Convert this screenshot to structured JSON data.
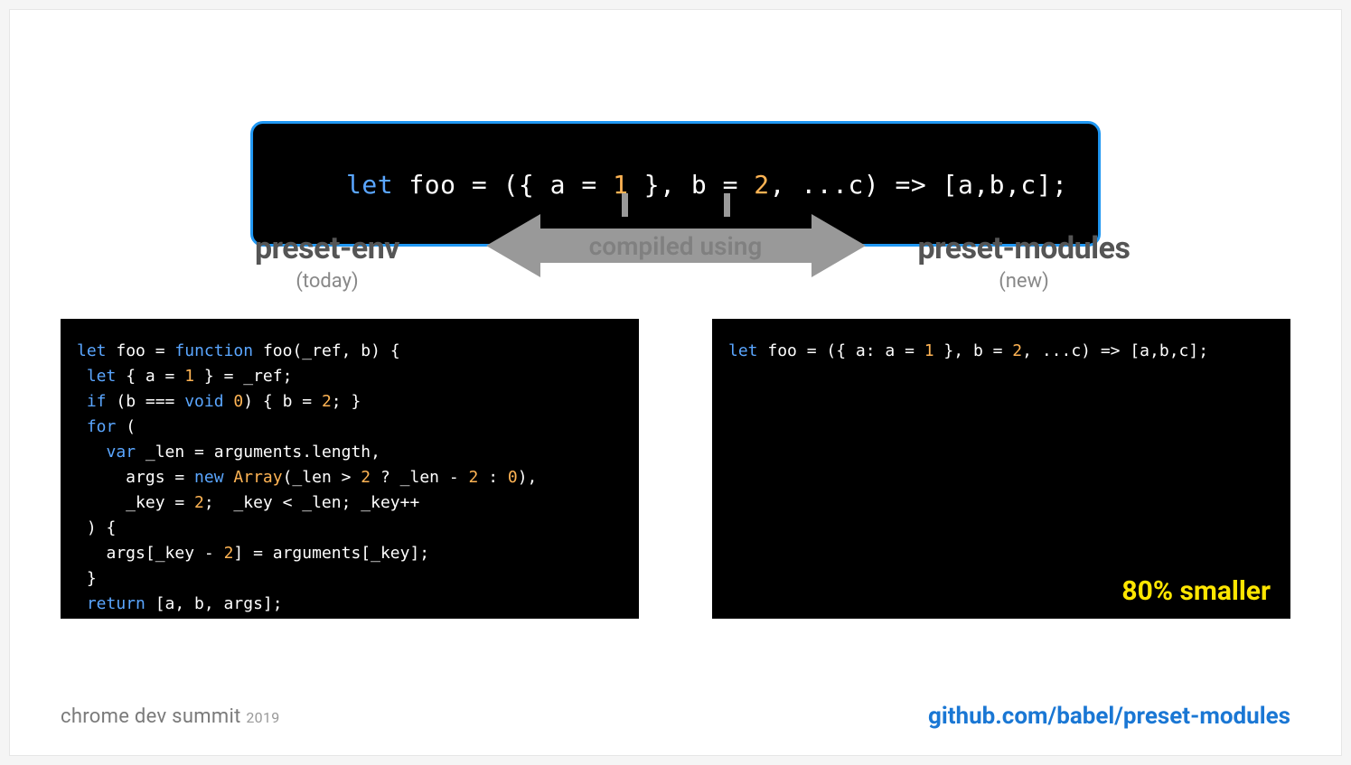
{
  "source": {
    "tokens": [
      {
        "t": "let ",
        "c": "kw"
      },
      {
        "t": "foo = ({ a = "
      },
      {
        "t": "1",
        "c": "num"
      },
      {
        "t": " }, b = "
      },
      {
        "t": "2",
        "c": "num"
      },
      {
        "t": ", ...c) => [a,b,c];"
      }
    ]
  },
  "arrow_label": "compiled using",
  "left": {
    "title": "preset-env",
    "subtitle": "(today)",
    "code_tokens": [
      {
        "t": "let ",
        "c": "kw"
      },
      {
        "t": "foo = "
      },
      {
        "t": "function ",
        "c": "kw"
      },
      {
        "t": "foo(_ref, b) {\n"
      },
      {
        "t": " "
      },
      {
        "t": "let ",
        "c": "kw"
      },
      {
        "t": "{ a = "
      },
      {
        "t": "1",
        "c": "num"
      },
      {
        "t": " } = _ref;\n"
      },
      {
        "t": " "
      },
      {
        "t": "if ",
        "c": "kw"
      },
      {
        "t": "(b === "
      },
      {
        "t": "void ",
        "c": "kw"
      },
      {
        "t": "0",
        "c": "num"
      },
      {
        "t": ") { b = "
      },
      {
        "t": "2",
        "c": "num"
      },
      {
        "t": "; }\n"
      },
      {
        "t": " "
      },
      {
        "t": "for ",
        "c": "kw"
      },
      {
        "t": "(\n"
      },
      {
        "t": "   "
      },
      {
        "t": "var ",
        "c": "kw"
      },
      {
        "t": "_len = arguments.length,\n"
      },
      {
        "t": "     args = "
      },
      {
        "t": "new ",
        "c": "kw"
      },
      {
        "t": "Array",
        "c": "fn"
      },
      {
        "t": "(_len > "
      },
      {
        "t": "2",
        "c": "num"
      },
      {
        "t": " ? _len - "
      },
      {
        "t": "2",
        "c": "num"
      },
      {
        "t": " : "
      },
      {
        "t": "0",
        "c": "num"
      },
      {
        "t": "),\n"
      },
      {
        "t": "     _key = "
      },
      {
        "t": "2",
        "c": "num"
      },
      {
        "t": ";  _key < _len; _key++\n"
      },
      {
        "t": " ) {\n"
      },
      {
        "t": "   args[_key - "
      },
      {
        "t": "2",
        "c": "num"
      },
      {
        "t": "] = arguments[_key];\n"
      },
      {
        "t": " }\n"
      },
      {
        "t": " "
      },
      {
        "t": "return ",
        "c": "kw"
      },
      {
        "t": "[a, b, args];\n"
      },
      {
        "t": "};"
      }
    ]
  },
  "right": {
    "title": "preset-modules",
    "subtitle": "(new)",
    "code_tokens": [
      {
        "t": "let ",
        "c": "kw"
      },
      {
        "t": "foo = ({ a: a = "
      },
      {
        "t": "1",
        "c": "num"
      },
      {
        "t": " }, b = "
      },
      {
        "t": "2",
        "c": "num"
      },
      {
        "t": ", ...c) => [a,b,c];"
      }
    ],
    "badge": "80% smaller"
  },
  "footer": {
    "event": "chrome dev summit",
    "year": "2019",
    "link": "github.com/babel/preset-modules"
  }
}
